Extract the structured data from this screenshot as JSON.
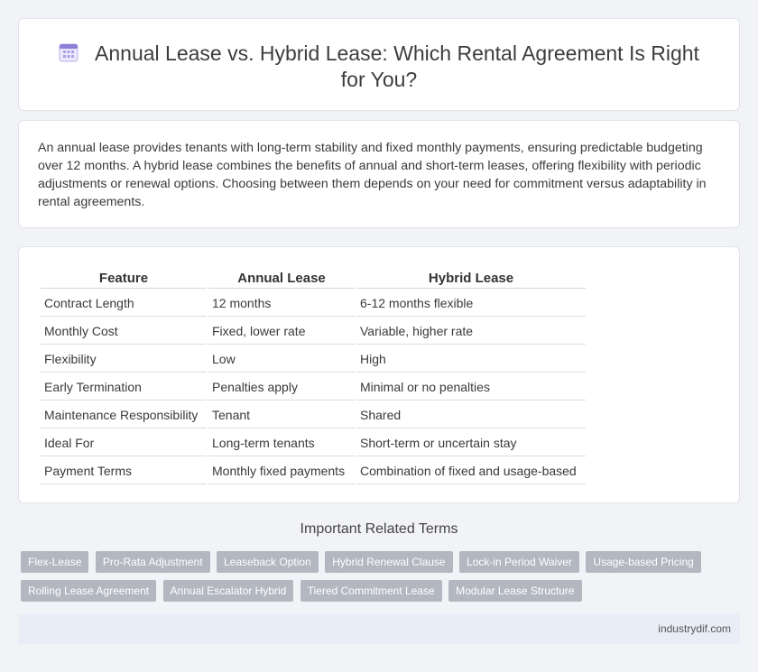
{
  "header": {
    "title": "Annual Lease vs. Hybrid Lease: Which Rental Agreement Is Right for You?",
    "icon": "calendar-icon"
  },
  "intro": {
    "text": "An annual lease provides tenants with long-term stability and fixed monthly payments, ensuring predictable budgeting over 12 months. A hybrid lease combines the benefits of annual and short-term leases, offering flexibility with periodic adjustments or renewal options. Choosing between them depends on your need for commitment versus adaptability in rental agreements."
  },
  "table": {
    "headers": [
      "Feature",
      "Annual Lease",
      "Hybrid Lease"
    ],
    "rows": [
      [
        "Contract Length",
        "12 months",
        "6-12 months flexible"
      ],
      [
        "Monthly Cost",
        "Fixed, lower rate",
        "Variable, higher rate"
      ],
      [
        "Flexibility",
        "Low",
        "High"
      ],
      [
        "Early Termination",
        "Penalties apply",
        "Minimal or no penalties"
      ],
      [
        "Maintenance Responsibility",
        "Tenant",
        "Shared"
      ],
      [
        "Ideal For",
        "Long-term tenants",
        "Short-term or uncertain stay"
      ],
      [
        "Payment Terms",
        "Monthly fixed payments",
        "Combination of fixed and usage-based"
      ]
    ]
  },
  "related": {
    "title": "Important Related Terms",
    "tags": [
      "Flex-Lease",
      "Pro-Rata Adjustment",
      "Leaseback Option",
      "Hybrid Renewal Clause",
      "Lock-in Period Waiver",
      "Usage-based Pricing",
      "Rolling Lease Agreement",
      "Annual Escalator Hybrid",
      "Tiered Commitment Lease",
      "Modular Lease Structure"
    ]
  },
  "footer": {
    "site": "industrydif.com"
  },
  "colors": {
    "background": "#f2f3f7",
    "tag": "#b3b7c0",
    "footer": "#e8edf6",
    "icon_accent": "#8b7fd6"
  }
}
